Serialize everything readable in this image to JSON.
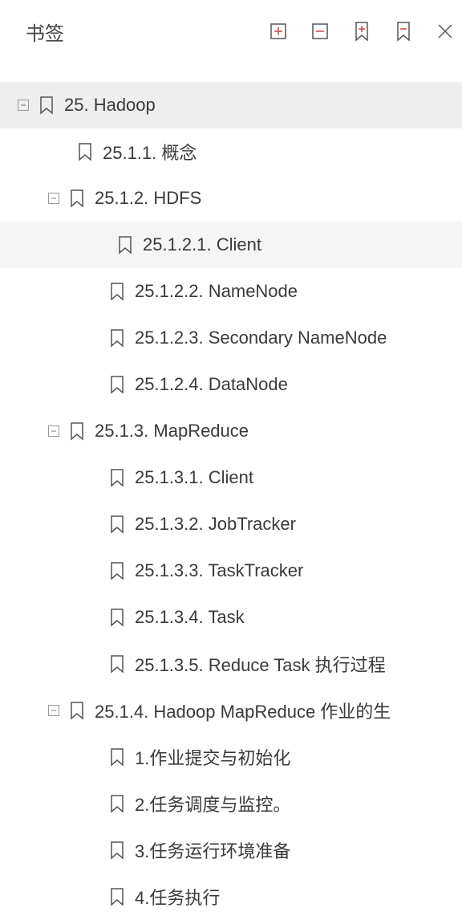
{
  "header": {
    "title": "书签"
  },
  "toolbar": {
    "icon_names": [
      "add-bookmark-folder-icon",
      "remove-bookmark-folder-icon",
      "add-bookmark-icon",
      "remove-bookmark-icon",
      "close-icon"
    ]
  },
  "tree": {
    "root": {
      "label": "25. Hadoop",
      "expanded": true,
      "selected": true,
      "children": [
        {
          "label": "25.1.1. 概念",
          "leaf": true
        },
        {
          "label": "25.1.2. HDFS",
          "expanded": true,
          "children": [
            {
              "label": "25.1.2.1.  Client",
              "selected": true
            },
            {
              "label": "25.1.2.2.  NameNode"
            },
            {
              "label": "25.1.2.3. Secondary NameNode"
            },
            {
              "label": "25.1.2.4. DataNode"
            }
          ]
        },
        {
          "label": "25.1.3. MapReduce",
          "expanded": true,
          "children": [
            {
              "label": "25.1.3.1.  Client"
            },
            {
              "label": "25.1.3.2.  JobTracker"
            },
            {
              "label": "25.1.3.3. TaskTracker"
            },
            {
              "label": "25.1.3.4.  Task"
            },
            {
              "label": "25.1.3.5. Reduce Task 执行过程"
            }
          ]
        },
        {
          "label": "25.1.4. Hadoop MapReduce 作业的生",
          "expanded": true,
          "children": [
            {
              "label": "1.作业提交与初始化"
            },
            {
              "label": "2.任务调度与监控。"
            },
            {
              "label": "3.任务运行环境准备"
            },
            {
              "label": "4.任务执行"
            }
          ]
        }
      ]
    }
  }
}
